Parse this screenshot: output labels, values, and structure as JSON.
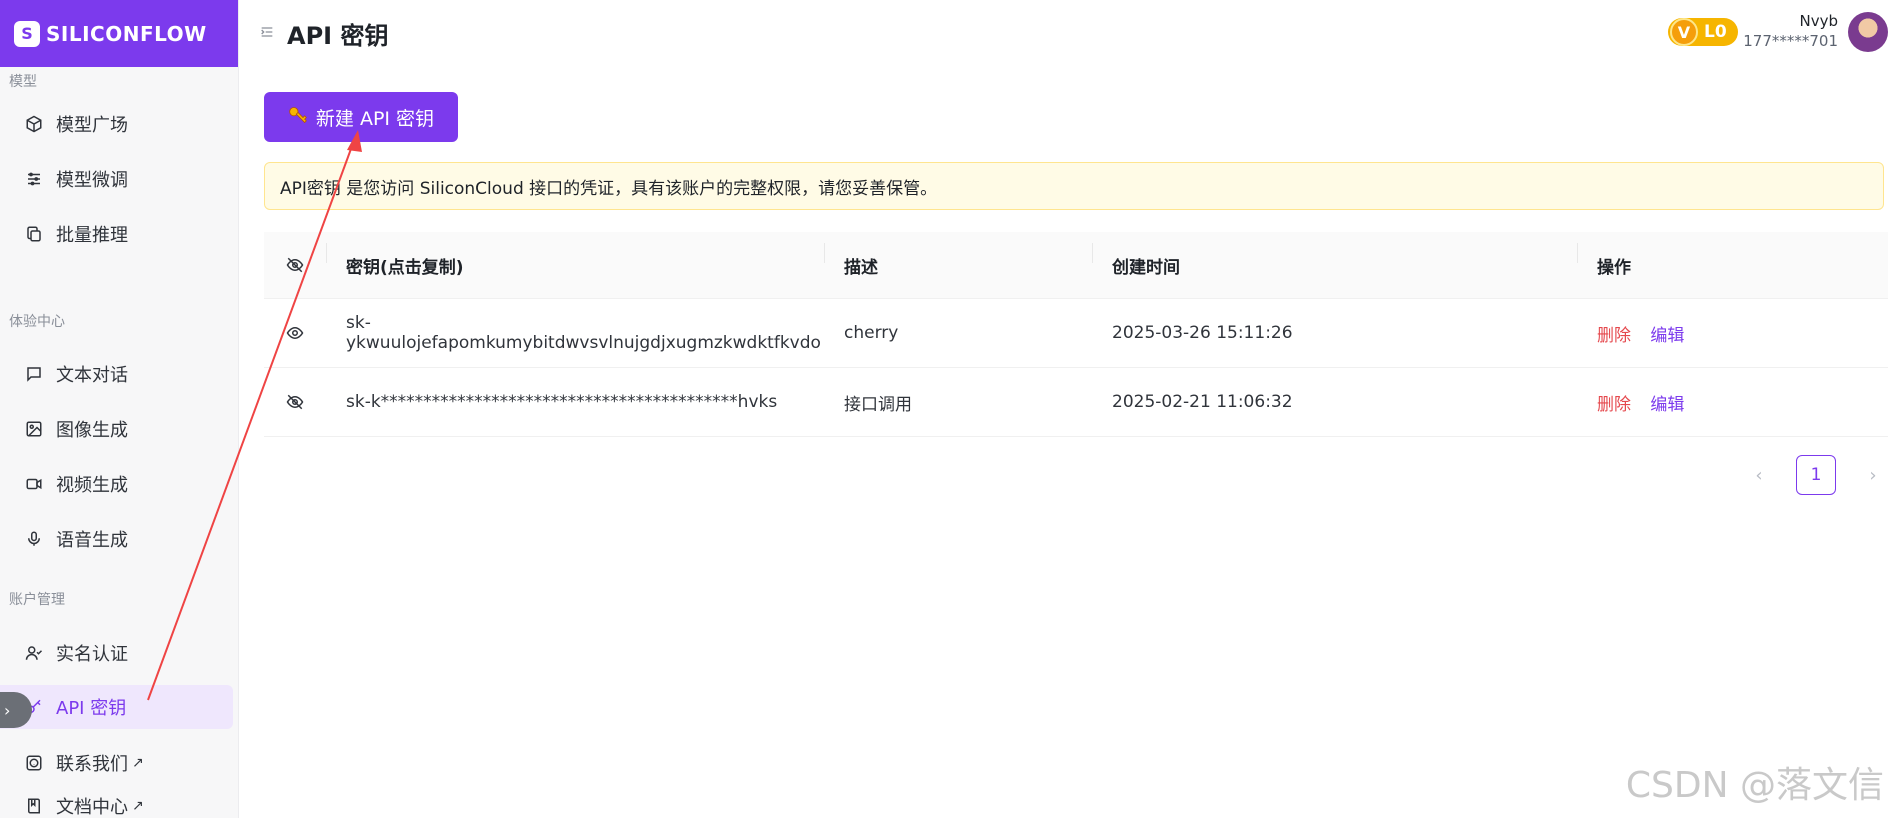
{
  "brand": {
    "name": "SILICONFLOW",
    "accent": "#7c3aed"
  },
  "sidebar": {
    "sections": [
      {
        "title": "模型",
        "items": [
          {
            "label": "模型广场",
            "icon": "cube-icon"
          },
          {
            "label": "模型微调",
            "icon": "sliders-icon"
          },
          {
            "label": "批量推理",
            "icon": "copy-icon"
          }
        ]
      },
      {
        "title": "体验中心",
        "items": [
          {
            "label": "文本对话",
            "icon": "chat-icon"
          },
          {
            "label": "图像生成",
            "icon": "image-icon"
          },
          {
            "label": "视频生成",
            "icon": "video-icon"
          },
          {
            "label": "语音生成",
            "icon": "mic-icon"
          }
        ]
      },
      {
        "title": "账户管理",
        "items": [
          {
            "label": "实名认证",
            "icon": "user-check-icon"
          },
          {
            "label": "API 密钥",
            "icon": "key-icon",
            "active": true
          }
        ]
      }
    ],
    "links": [
      {
        "label": "联系我们",
        "icon": "question-icon",
        "external": "↗"
      },
      {
        "label": "文档中心",
        "icon": "book-icon",
        "external": "↗"
      }
    ]
  },
  "header": {
    "title": "API 密钥",
    "vip": {
      "letter": "V",
      "level": "L0"
    },
    "user": {
      "name": "Nvyb",
      "phone": "177*****701"
    }
  },
  "main": {
    "create_button": "新建 API 密钥",
    "notice": "API密钥 是您访问 SiliconCloud 接口的凭证，具有该账户的完整权限，请您妥善保管。",
    "table": {
      "columns": [
        "密钥(点击复制)",
        "描述",
        "创建时间",
        "操作"
      ],
      "rows": [
        {
          "key": "sk-ykwuulojefapomkumybitdwvsvlnujgdjxugmzkwdktfkvdo",
          "desc": "cherry",
          "time": "2025-03-26 15:11:26",
          "visible": true
        },
        {
          "key": "sk-k******************************************hvks",
          "desc": "接口调用",
          "time": "2025-02-21 11:06:32",
          "visible": false
        }
      ],
      "actions": {
        "delete": "删除",
        "edit": "编辑"
      }
    },
    "pagination": {
      "current": "1",
      "prev": "‹",
      "next": "›"
    }
  },
  "watermark": "CSDN @落文信",
  "annotation": {
    "color": "#ef4444"
  }
}
